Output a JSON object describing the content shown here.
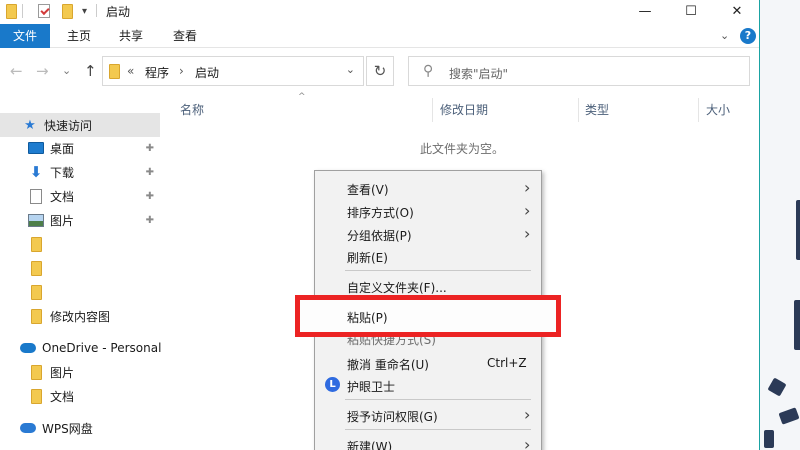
{
  "window": {
    "title": "启动",
    "minimize_glyph": "—",
    "maximize_glyph": "☐",
    "close_glyph": "✕"
  },
  "quick_access_toolbar": {
    "icons": [
      "folder-icon",
      "properties-check-icon",
      "new-folder-icon"
    ],
    "dropdown_glyph": "▾"
  },
  "ribbon": {
    "tabs": [
      "文件",
      "主页",
      "共享",
      "查看"
    ],
    "expand_glyph": "⌄",
    "help_glyph": "?"
  },
  "navigation": {
    "back_glyph": "←",
    "forward_glyph": "→",
    "recent_glyph": "⌄",
    "up_glyph": "↑",
    "refresh_glyph": "↻"
  },
  "address_bar": {
    "overflow": "«",
    "crumbs": [
      "程序",
      "启动"
    ],
    "separator": "›",
    "dropdown_glyph": "⌄"
  },
  "search": {
    "placeholder": "搜索\"启动\"",
    "icon_glyph": "⚲"
  },
  "sidebar": {
    "items": [
      {
        "label": "快速访问",
        "icon": "star-icon",
        "pinned": false,
        "selected": true
      },
      {
        "label": "桌面",
        "icon": "desktop-icon",
        "pinned": true
      },
      {
        "label": "下载",
        "icon": "download-icon",
        "pinned": true
      },
      {
        "label": "文档",
        "icon": "document-icon",
        "pinned": true
      },
      {
        "label": "图片",
        "icon": "pictures-icon",
        "pinned": true
      },
      {
        "label": "",
        "icon": "folder-icon"
      },
      {
        "label": "",
        "icon": "folder-icon"
      },
      {
        "label": "",
        "icon": "folder-icon"
      },
      {
        "label": "修改内容图",
        "icon": "folder-icon"
      },
      {
        "label": "OneDrive - Personal",
        "icon": "onedrive-icon"
      },
      {
        "label": "图片",
        "icon": "folder-icon"
      },
      {
        "label": "文档",
        "icon": "folder-icon"
      },
      {
        "label": "WPS网盘",
        "icon": "wps-cloud-icon"
      }
    ],
    "pin_glyph": "📌"
  },
  "columns": {
    "name": "名称",
    "modified": "修改日期",
    "type": "类型",
    "size": "大小",
    "sort_glyph": "^"
  },
  "empty_message": "此文件夹为空。",
  "context_menu": {
    "items": [
      {
        "label": "查看(V)",
        "submenu": true
      },
      {
        "label": "排序方式(O)",
        "submenu": true
      },
      {
        "label": "分组依据(P)",
        "submenu": true
      },
      {
        "label": "刷新(E)"
      },
      {
        "label": "自定义文件夹(F)..."
      },
      {
        "label": "粘贴(P)",
        "highlighted": true
      },
      {
        "label": "粘贴快捷方式(S)",
        "obscured": true
      },
      {
        "label": "撤消 重命名(U)",
        "shortcut": "Ctrl+Z"
      },
      {
        "label": "护眼卫士",
        "icon": "eye-guard-icon",
        "icon_glyph": "L"
      },
      {
        "label": "授予访问权限(G)",
        "submenu": true
      },
      {
        "label": "新建(W)",
        "submenu": true
      }
    ],
    "submenu_glyph": "›"
  },
  "colors": {
    "accent": "#1979ca",
    "highlight_box": "#ec2323",
    "window_border": "#1aa3a3"
  }
}
